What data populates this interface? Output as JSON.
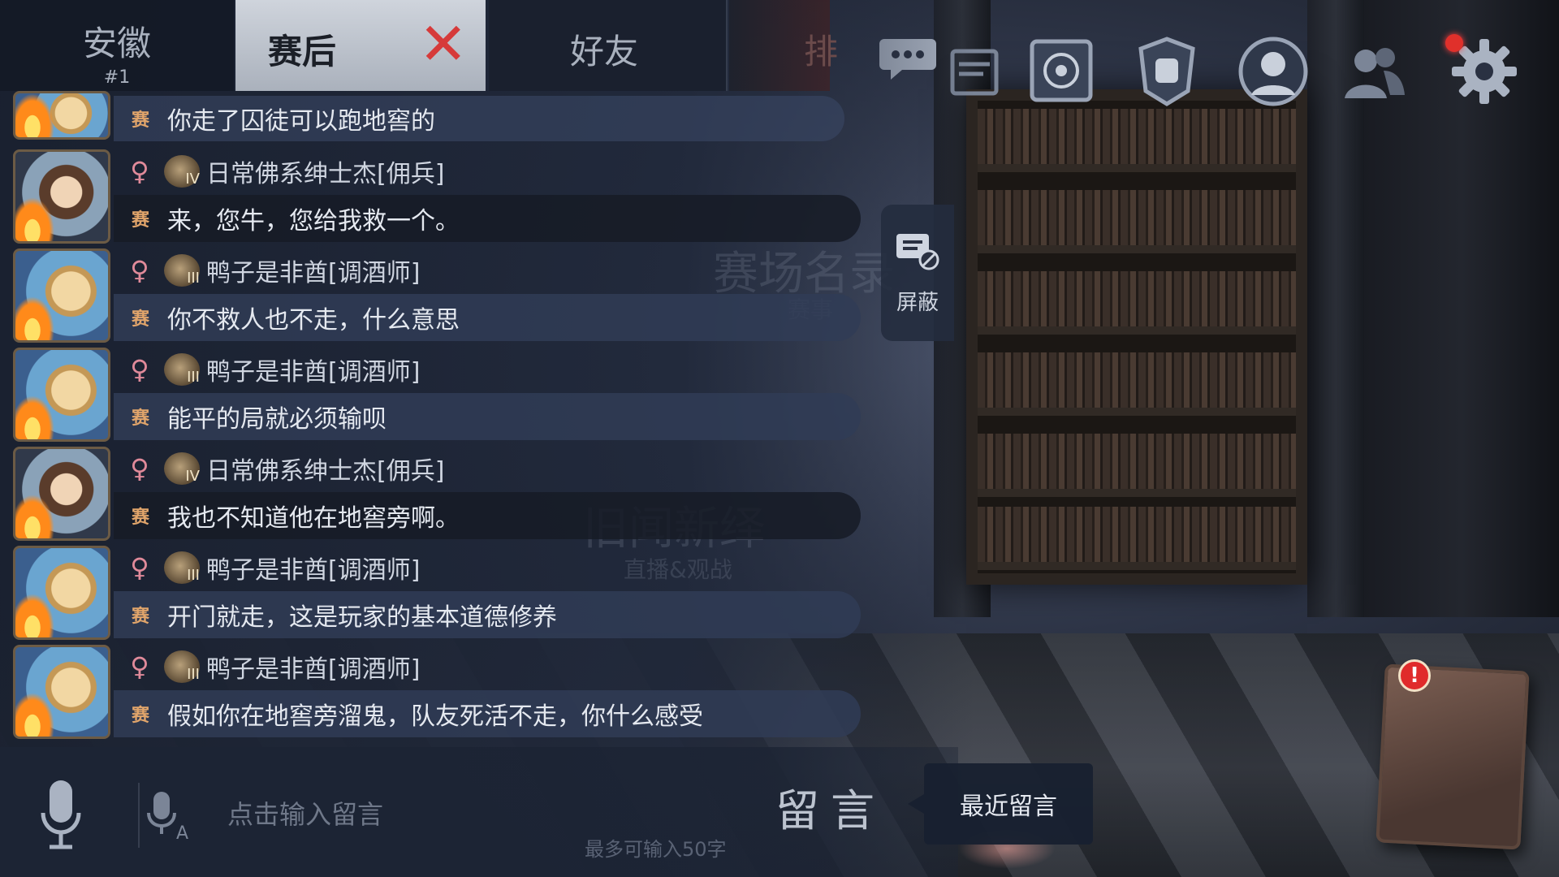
{
  "tabs": {
    "region": {
      "name": "安徽",
      "rank": "#1"
    },
    "active": {
      "label": "赛后",
      "close_symbol": "✕"
    },
    "friends": {
      "label": "好友"
    },
    "partial": {
      "label": "排"
    }
  },
  "top_icons": [
    {
      "icon": "chat-bubble-icon"
    },
    {
      "icon": "folder-icon"
    },
    {
      "icon": "emblem-card-icon"
    },
    {
      "icon": "fist-icon"
    },
    {
      "icon": "character-portrait-icon"
    },
    {
      "icon": "friends-icon"
    },
    {
      "icon": "settings-gear-icon"
    }
  ],
  "match_tag": "赛",
  "messages": [
    {
      "type": "continuation",
      "text": "你走了囚徒可以跑地窖的"
    },
    {
      "type": "message",
      "avatar": "dark",
      "gender": "♀",
      "badge": "IV",
      "sender": "日常佛系绅士杰[佣兵]",
      "text": "来，您牛，您给我救一个。"
    },
    {
      "type": "message",
      "avatar": "blonde",
      "gender": "♀",
      "badge": "III",
      "sender": "鸭子是非酋[调酒师]",
      "text": "你不救人也不走，什么意思"
    },
    {
      "type": "message",
      "avatar": "blonde",
      "gender": "♀",
      "badge": "III",
      "sender": "鸭子是非酋[调酒师]",
      "text": "能平的局就必须输呗"
    },
    {
      "type": "message",
      "avatar": "dark",
      "gender": "♀",
      "badge": "IV",
      "sender": "日常佛系绅士杰[佣兵]",
      "text": "我也不知道他在地窖旁啊。"
    },
    {
      "type": "message",
      "avatar": "blonde",
      "gender": "♀",
      "badge": "III",
      "sender": "鸭子是非酋[调酒师]",
      "text": "开门就走，这是玩家的基本道德修养"
    },
    {
      "type": "message",
      "avatar": "blonde",
      "gender": "♀",
      "badge": "III",
      "sender": "鸭子是非酋[调酒师]",
      "text": "假如你在地窖旁溜鬼，队友死活不走，你什么感受"
    }
  ],
  "block_button": {
    "label": "屏蔽"
  },
  "background_texts": {
    "arena": "赛场名录",
    "arena_sub": "赛事",
    "news": "旧闻新绎",
    "news_sub": "直播&观战"
  },
  "input": {
    "placeholder": "点击输入留言",
    "value": "",
    "limit_hint": "最多可输入50字"
  },
  "leave_message_label": "留言",
  "recent_messages_label": "最近留言",
  "diary_alert": "!",
  "colors": {
    "panel_bg": "#1f2738",
    "active_tab": "#c4cad3",
    "close_red": "#d63a3a",
    "match_tag_orange": "#e1a56b",
    "gender_pink": "#e08a9a"
  }
}
